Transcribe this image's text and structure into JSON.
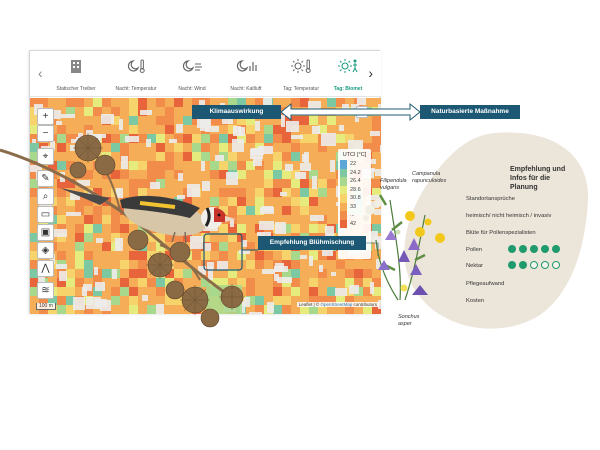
{
  "toolbar": {
    "items": [
      {
        "label": "Statischer Treiber",
        "icon": "building-icon",
        "active": false
      },
      {
        "label": "Nacht: Temperatur",
        "icon": "moon-thermometer-icon",
        "active": false
      },
      {
        "label": "Nacht: Wind",
        "icon": "moon-wind-icon",
        "active": false
      },
      {
        "label": "Nacht: Kaltluft",
        "icon": "moon-bars-icon",
        "active": false
      },
      {
        "label": "Tag: Temperatur",
        "icon": "sun-thermometer-icon",
        "active": false
      },
      {
        "label": "Tag: Biomet",
        "icon": "sun-figure-icon",
        "active": true
      }
    ]
  },
  "map": {
    "zoom_in": "+",
    "zoom_out": "−",
    "scale": "100 m",
    "attribution_prefix": "Leaflet | © ",
    "attribution_link": "OpenStreetMap",
    "attribution_suffix": " contributors"
  },
  "legend": {
    "title": "UTCI [°C]",
    "entries": [
      {
        "value": "22",
        "color": "#5ba8d6"
      },
      {
        "value": "24.2",
        "color": "#7cc8a3"
      },
      {
        "value": "26.4",
        "color": "#a8d88c"
      },
      {
        "value": "28.6",
        "color": "#e5eb7c"
      },
      {
        "value": "30.8",
        "color": "#f7d36b"
      },
      {
        "value": "33",
        "color": "#f5ad57"
      },
      {
        "value": "...",
        "color": "#f28c4a"
      },
      {
        "value": "42",
        "color": "#e8653b"
      }
    ]
  },
  "callouts": {
    "klima": "Klimaauswirkung",
    "natur": "Naturbasierte Maßnahme",
    "bluh": "Empfehlung Blühmischung"
  },
  "plants": {
    "campanula": "Campanula\nrapunculoides",
    "filipendula": "Filipendula\nvulgaris",
    "sonchus": "Sonchus\nasper"
  },
  "info": {
    "title": "Empfehlung und Infos für die Planung",
    "rows": {
      "standort": "Standortansprüche",
      "heimisch": "heimisch/ nicht heimisch / invasiv",
      "bluete": "Blüte für Pollenspezialisten",
      "pollen": "Pollen",
      "nektar": "Nektar",
      "pflege": "Pflegeaufwand",
      "kosten": "Kosten"
    },
    "pollen_rating": 5,
    "nektar_rating": 2,
    "rating_max": 5,
    "accent_color": "#1f9a6d",
    "blob_color": "#ece5d9"
  }
}
